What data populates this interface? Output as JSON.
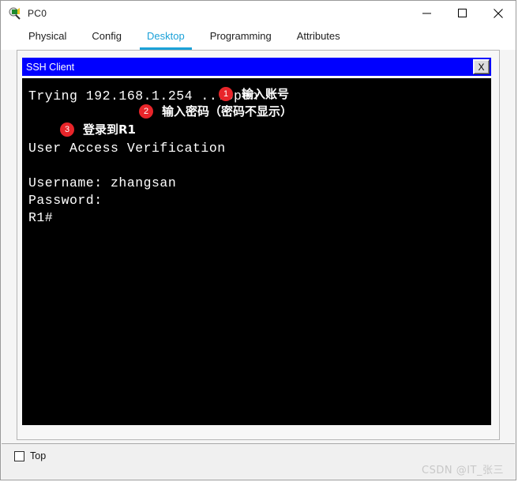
{
  "window": {
    "title": "PC0",
    "icon": "pc-device-icon",
    "buttons": {
      "minimize": "—",
      "maximize": "□",
      "close": "✕"
    }
  },
  "tabs": [
    {
      "label": "Physical",
      "active": false
    },
    {
      "label": "Config",
      "active": false
    },
    {
      "label": "Desktop",
      "active": true
    },
    {
      "label": "Programming",
      "active": false
    },
    {
      "label": "Attributes",
      "active": false
    }
  ],
  "ssh": {
    "title": "SSH Client",
    "close_label": "X",
    "terminal_lines": [
      "Trying 192.168.1.254 ...Open",
      "",
      "",
      "User Access Verification",
      "",
      "Username: zhangsan",
      "Password:",
      "R1#"
    ]
  },
  "annotations": [
    {
      "number": "1",
      "text": "输入账号"
    },
    {
      "number": "2",
      "text": "输入密码（密码不显示）"
    },
    {
      "number": "3",
      "text": "登录到R1"
    }
  ],
  "footer": {
    "top_checkbox_label": "Top",
    "top_checkbox_checked": false,
    "watermark": "CSDN @IT_张三"
  },
  "colors": {
    "accent_tab": "#1ba1d8",
    "ssh_titlebar": "#0000ff",
    "badge": "#e8252a",
    "terminal_bg": "#000000",
    "terminal_fg": "#ffffff"
  }
}
